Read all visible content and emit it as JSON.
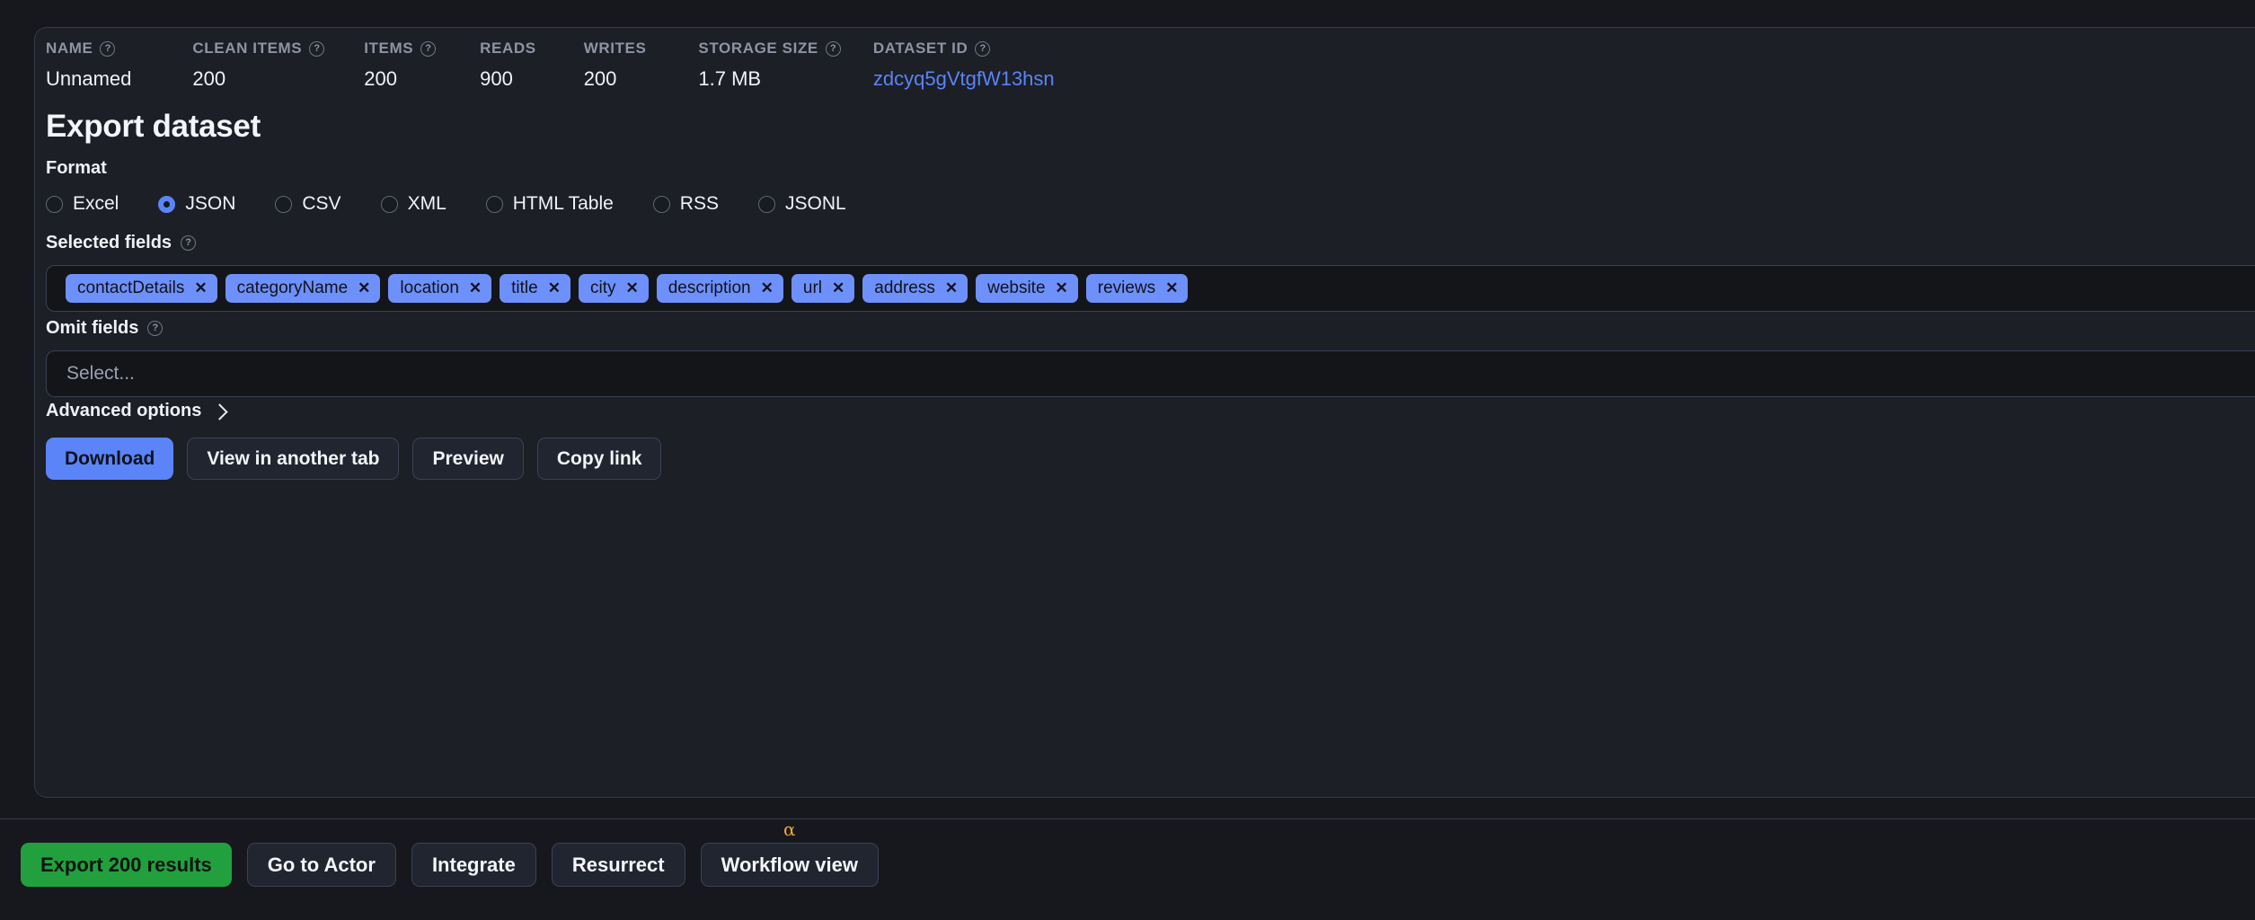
{
  "stats": [
    {
      "label": "NAME",
      "value": "Unnamed",
      "has_help": true,
      "is_link": false,
      "gap": 68
    },
    {
      "label": "CLEAN ITEMS",
      "value": "200",
      "has_help": true,
      "is_link": false,
      "gap": 44
    },
    {
      "label": "ITEMS",
      "value": "200",
      "has_help": true,
      "is_link": false,
      "gap": 49
    },
    {
      "label": "READS",
      "value": "900",
      "has_help": false,
      "is_link": false,
      "gap": 53
    },
    {
      "label": "WRITES",
      "value": "200",
      "has_help": false,
      "is_link": false,
      "gap": 58
    },
    {
      "label": "STORAGE SIZE",
      "value": "1.7 MB",
      "has_help": true,
      "is_link": false,
      "gap": 36
    },
    {
      "label": "DATASET ID",
      "value": "zdcyq5gVtgfW13hsn",
      "has_help": true,
      "is_link": true,
      "gap": 0
    }
  ],
  "page": {
    "title": "Export dataset"
  },
  "format": {
    "label": "Format",
    "selected": "JSON",
    "options": [
      "Excel",
      "JSON",
      "CSV",
      "XML",
      "HTML Table",
      "RSS",
      "JSONL"
    ]
  },
  "selected_fields": {
    "label": "Selected fields",
    "help_icon": "question-mark-icon",
    "chips": [
      "contactDetails",
      "categoryName",
      "location",
      "title",
      "city",
      "description",
      "url",
      "address",
      "website",
      "reviews"
    ],
    "remove_glyph": "✕"
  },
  "omit_fields": {
    "label": "Omit fields",
    "help_icon": "question-mark-icon",
    "value": "",
    "placeholder": "Select..."
  },
  "advanced": {
    "label": "Advanced options",
    "icon": "chevron-right-icon",
    "expanded": false
  },
  "actions": [
    {
      "label": "Download",
      "style": "primary"
    },
    {
      "label": "View in another tab",
      "style": "ghost"
    },
    {
      "label": "Preview",
      "style": "ghost"
    },
    {
      "label": "Copy link",
      "style": "ghost"
    }
  ],
  "bottom_bar": [
    {
      "label": "Export 200 results",
      "style": "export",
      "badge": null
    },
    {
      "label": "Go to Actor",
      "style": "dark",
      "badge": null
    },
    {
      "label": "Integrate",
      "style": "dark",
      "badge": null
    },
    {
      "label": "Resurrect",
      "style": "dark",
      "badge": null
    },
    {
      "label": "Workflow view",
      "style": "dark",
      "badge": "α"
    }
  ],
  "colors": {
    "page_background": "#16181d",
    "card_background": "#1c1f26",
    "accent_blue": "#5a84f7",
    "chip_blue": "#6e90fb",
    "export_green": "#22a03e",
    "alpha_orange": "#f2a33c",
    "border": "#3b4256",
    "muted_text": "#8d94a5"
  }
}
